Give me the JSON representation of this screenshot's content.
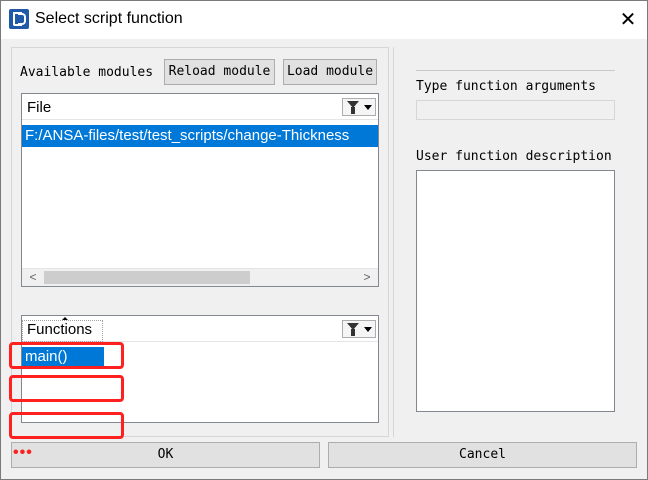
{
  "window": {
    "title": "Select script function",
    "close_glyph": "✕"
  },
  "modules": {
    "label": "Available modules",
    "reload_label": "Reload module",
    "load_label": "Load module",
    "list_header": "File",
    "files": [
      "F:/ANSA-files/test/test_scripts/change-Thickness"
    ],
    "selected_file": "F:/ANSA-files/test/test_scripts/change-Thickness"
  },
  "functions": {
    "list_header": "Functions",
    "items": [
      "main()"
    ],
    "selected": "main()"
  },
  "right_panel": {
    "args_label": "Type function arguments",
    "args_value": "",
    "desc_label": "User function description",
    "desc_value": ""
  },
  "footer": {
    "ok_label": "OK",
    "cancel_label": "Cancel",
    "dots": "•••"
  },
  "icons": {
    "app": "ansa-app-icon",
    "filter": "filter-icon",
    "dropdown": "chevron-down-icon",
    "scroll_left": "arrow-left-icon",
    "scroll_right": "arrow-right-icon"
  },
  "colors": {
    "selection": "#0078d7",
    "annotation": "#ff2020",
    "panel": "#f0f0f0"
  }
}
